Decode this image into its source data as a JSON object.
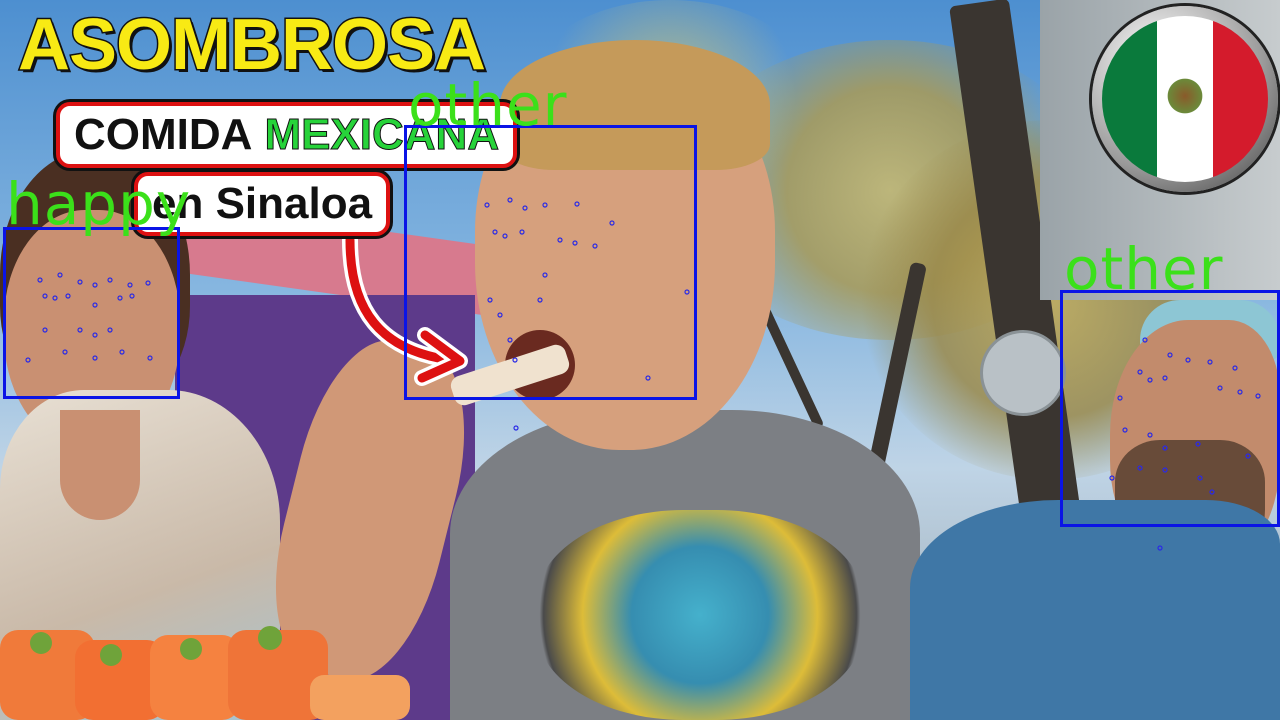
{
  "thumbnail": {
    "title": "ASOMBROSA",
    "subtitle_part1": "COMIDA",
    "subtitle_part2": "MEXICANA",
    "subtitle_line2": "en Sinaloa"
  },
  "colors": {
    "title_yellow": "#f8ea14",
    "accent_green": "#27d33a",
    "accent_red": "#dd1111",
    "box_blue": "#0a14e6",
    "label_green": "#3be01a"
  },
  "faces": [
    {
      "label": "happy"
    },
    {
      "label": "other"
    },
    {
      "label": "other"
    }
  ],
  "icons": {
    "badge": "mexico-flag-icon",
    "arrow": "curved-arrow-icon"
  }
}
